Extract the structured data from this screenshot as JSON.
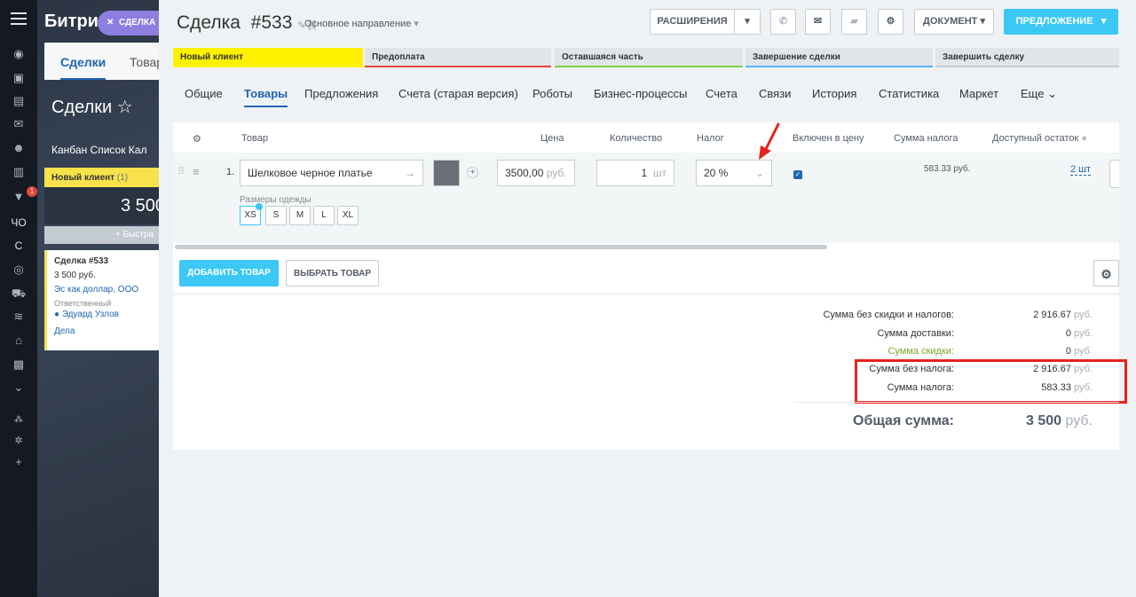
{
  "background": {
    "brand": "Битрик",
    "tabs": [
      "Сделки",
      "Товар"
    ],
    "title": "Сделки",
    "views": "Канбан  Список  Кал",
    "column": {
      "name": "Новый клиент",
      "count": "(1)",
      "sum": "3 500",
      "quick": "+ Быстра"
    },
    "card": {
      "title": "Сделка #533",
      "price": "3 500 руб.",
      "company": "Эс как доллар, ООО",
      "responsible_label": "Ответственный",
      "responsible": "Эдуард Узлов",
      "link": "Дела"
    },
    "rail_badge": "1",
    "rail_text": [
      "ЧО",
      "С"
    ]
  },
  "close_label": "СДЕЛКА",
  "header": {
    "title": "Сделка",
    "number": "#533",
    "direction": "Основное направление",
    "buttons": {
      "extensions": "РАСШИРЕНИЯ",
      "document": "ДОКУМЕНТ",
      "offer": "ПРЕДЛОЖЕНИЕ"
    }
  },
  "stages": [
    {
      "label": "Новый клиент",
      "color": "#fff200"
    },
    {
      "label": "Предоплата",
      "color": "#e5473d"
    },
    {
      "label": "Оставшаяся часть",
      "color": "#7bd144"
    },
    {
      "label": "Завершение сделки",
      "color": "#55b4f5"
    },
    {
      "label": "Завершить сделку",
      "color": "#c6cdd3"
    }
  ],
  "tabs": [
    "Общие",
    "Товары",
    "Предложения",
    "Счета (старая версия)",
    "Роботы",
    "Бизнес-процессы",
    "Счета",
    "Связи",
    "История",
    "Статистика",
    "Маркет",
    "Еще"
  ],
  "products": {
    "headers": {
      "product": "Товар",
      "price": "Цена",
      "qty": "Количество",
      "tax": "Налог",
      "included": "Включен в цену",
      "tax_sum": "Сумма налога",
      "stock": "Доступный остаток"
    },
    "row": {
      "index": "1.",
      "name": "Шелковое черное платье",
      "price": "3500,00",
      "price_cur": "руб.",
      "qty": "1",
      "unit": "шт",
      "tax": "20 %",
      "included": true,
      "tax_sum": "583.33 руб.",
      "stock": "2 шт",
      "sizes_label": "Размеры одежды",
      "sizes": [
        "XS",
        "S",
        "M",
        "L",
        "XL"
      ],
      "selected_size": "XS"
    }
  },
  "actions": {
    "add": "ДОБАВИТЬ ТОВАР",
    "choose": "ВЫБРАТЬ ТОВАР"
  },
  "totals": {
    "no_discount_tax_label": "Сумма без скидки и налогов:",
    "no_discount_tax_value": "2 916.67",
    "delivery_label": "Сумма доставки:",
    "delivery_value": "0",
    "discount_label": "Сумма скидки:",
    "discount_value": "0",
    "no_tax_label": "Сумма без налога:",
    "no_tax_value": "2 916.67",
    "tax_label": "Сумма налога:",
    "tax_value": "583.33",
    "currency": "руб.",
    "total_label": "Общая сумма:",
    "total_value": "3 500",
    "total_currency": "руб."
  },
  "colors": {
    "accent": "#3bc8f5",
    "link": "#2066b0",
    "discount": "#80a72a",
    "highlight": "#e5221d"
  }
}
